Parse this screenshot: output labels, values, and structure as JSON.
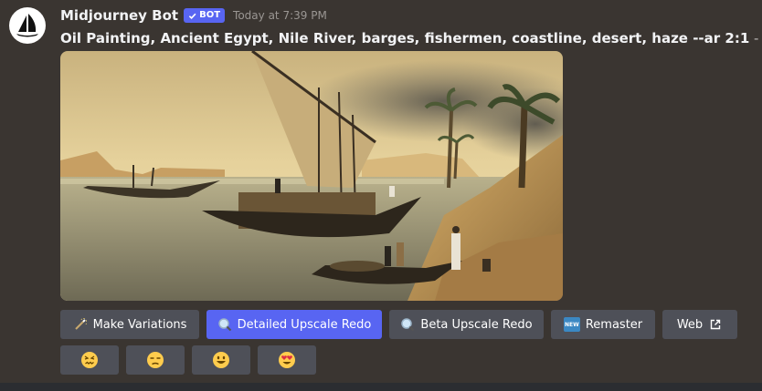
{
  "message": {
    "author": "Midjourney Bot",
    "badge_label": "BOT",
    "timestamp": "Today at 7:39 PM",
    "prompt": "Oil Painting, Ancient Egypt, Nile River, barges, fishermen, coastline, desert, haze --ar 2:1",
    "prompt_suffix": " - Upscaled (Detailed) by",
    "image_subject": "oil painting of sail barges and fishermen on the Nile with palm trees and hazy desert cliffs"
  },
  "buttons": [
    {
      "label": "Make Variations",
      "icon": "magic-wand-icon",
      "style": "secondary"
    },
    {
      "label": "Detailed Upscale Redo",
      "icon": "magnifier-icon",
      "style": "primary"
    },
    {
      "label": "Beta Upscale Redo",
      "icon": "magnifier-icon",
      "style": "secondary"
    },
    {
      "label": "Remaster",
      "icon": "new-icon",
      "style": "secondary"
    },
    {
      "label": "Web",
      "icon": "external-link-icon",
      "style": "secondary"
    }
  ],
  "new_icon_text": "NEW",
  "reactions": [
    {
      "icon": "confounded-face-icon"
    },
    {
      "icon": "unamused-face-icon"
    },
    {
      "icon": "grinning-face-icon"
    },
    {
      "icon": "heart-eyes-face-icon"
    }
  ],
  "colors": {
    "background": "#3a3531",
    "button": "#4e5058",
    "primary_button": "#5865f2",
    "bot_badge": "#5865f2",
    "username": "#f2f3f5",
    "timestamp": "#9a9693"
  }
}
